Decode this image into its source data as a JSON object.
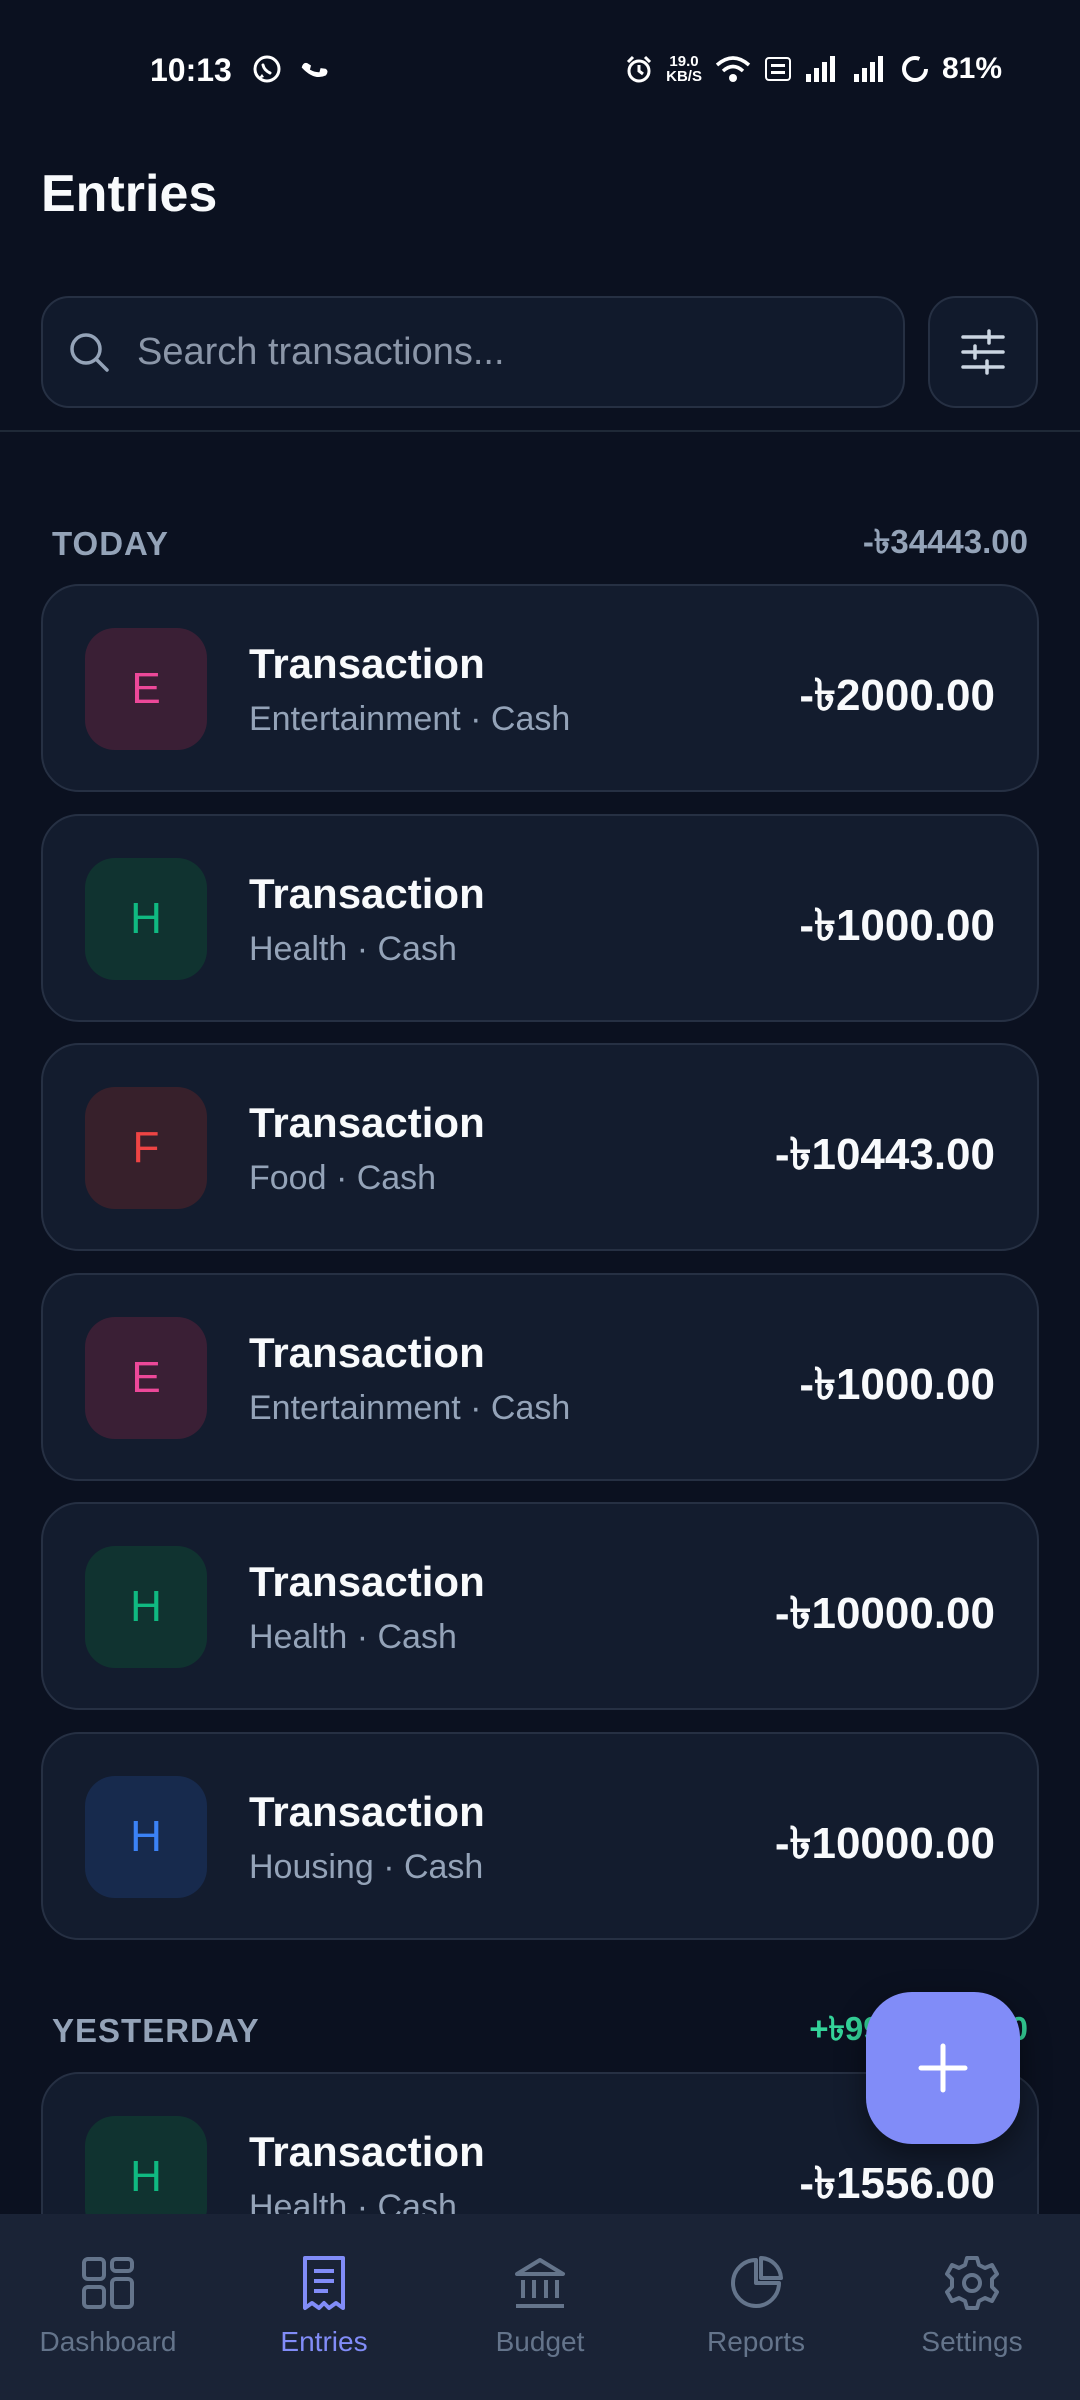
{
  "status_bar": {
    "time": "10:13",
    "net_speed_value": "19.0",
    "net_speed_unit": "KB/S",
    "battery": "81%",
    "icons": [
      "whatsapp-icon",
      "call-icon",
      "alarm-icon",
      "wifi-icon",
      "volte-icon",
      "signal-icon",
      "signal-icon",
      "battery-icon"
    ]
  },
  "header": {
    "title": "Entries"
  },
  "search": {
    "placeholder": "Search transactions..."
  },
  "groups": [
    {
      "label": "TODAY",
      "total": "-৳34443.00",
      "transactions": [
        {
          "initial": "E",
          "name": "Transaction",
          "meta": "Entertainment · Cash",
          "amount": "-৳2000.00"
        },
        {
          "initial": "H",
          "name": "Transaction",
          "meta": "Health · Cash",
          "amount": "-৳1000.00"
        },
        {
          "initial": "F",
          "name": "Transaction",
          "meta": "Food · Cash",
          "amount": "-৳10443.00"
        },
        {
          "initial": "E",
          "name": "Transaction",
          "meta": "Entertainment · Cash",
          "amount": "-৳1000.00"
        },
        {
          "initial": "H",
          "name": "Transaction",
          "meta": "Health · Cash",
          "amount": "-৳10000.00"
        },
        {
          "initial": "H",
          "name": "Transaction",
          "meta": "Housing · Cash",
          "amount": "-৳10000.00"
        }
      ]
    },
    {
      "label": "YESTERDAY",
      "total": "+৳99",
      "total_trailing": "0",
      "transactions": [
        {
          "initial": "H",
          "name": "Transaction",
          "meta": "Health · Cash",
          "amount": "-৳1556.00"
        }
      ]
    }
  ],
  "colors": {
    "background": "#0b1120",
    "card": "#131c2e",
    "accent": "#818cf8",
    "positive": "#34d399",
    "entertainment": "#ec4899",
    "health": "#10b981",
    "food": "#ef4444",
    "housing": "#3b82f6"
  },
  "nav": {
    "items": [
      {
        "label": "Dashboard",
        "icon": "dashboard-icon"
      },
      {
        "label": "Entries",
        "icon": "entries-icon"
      },
      {
        "label": "Budget",
        "icon": "budget-icon"
      },
      {
        "label": "Reports",
        "icon": "reports-icon"
      },
      {
        "label": "Settings",
        "icon": "gear-icon"
      }
    ],
    "active": "Entries"
  }
}
